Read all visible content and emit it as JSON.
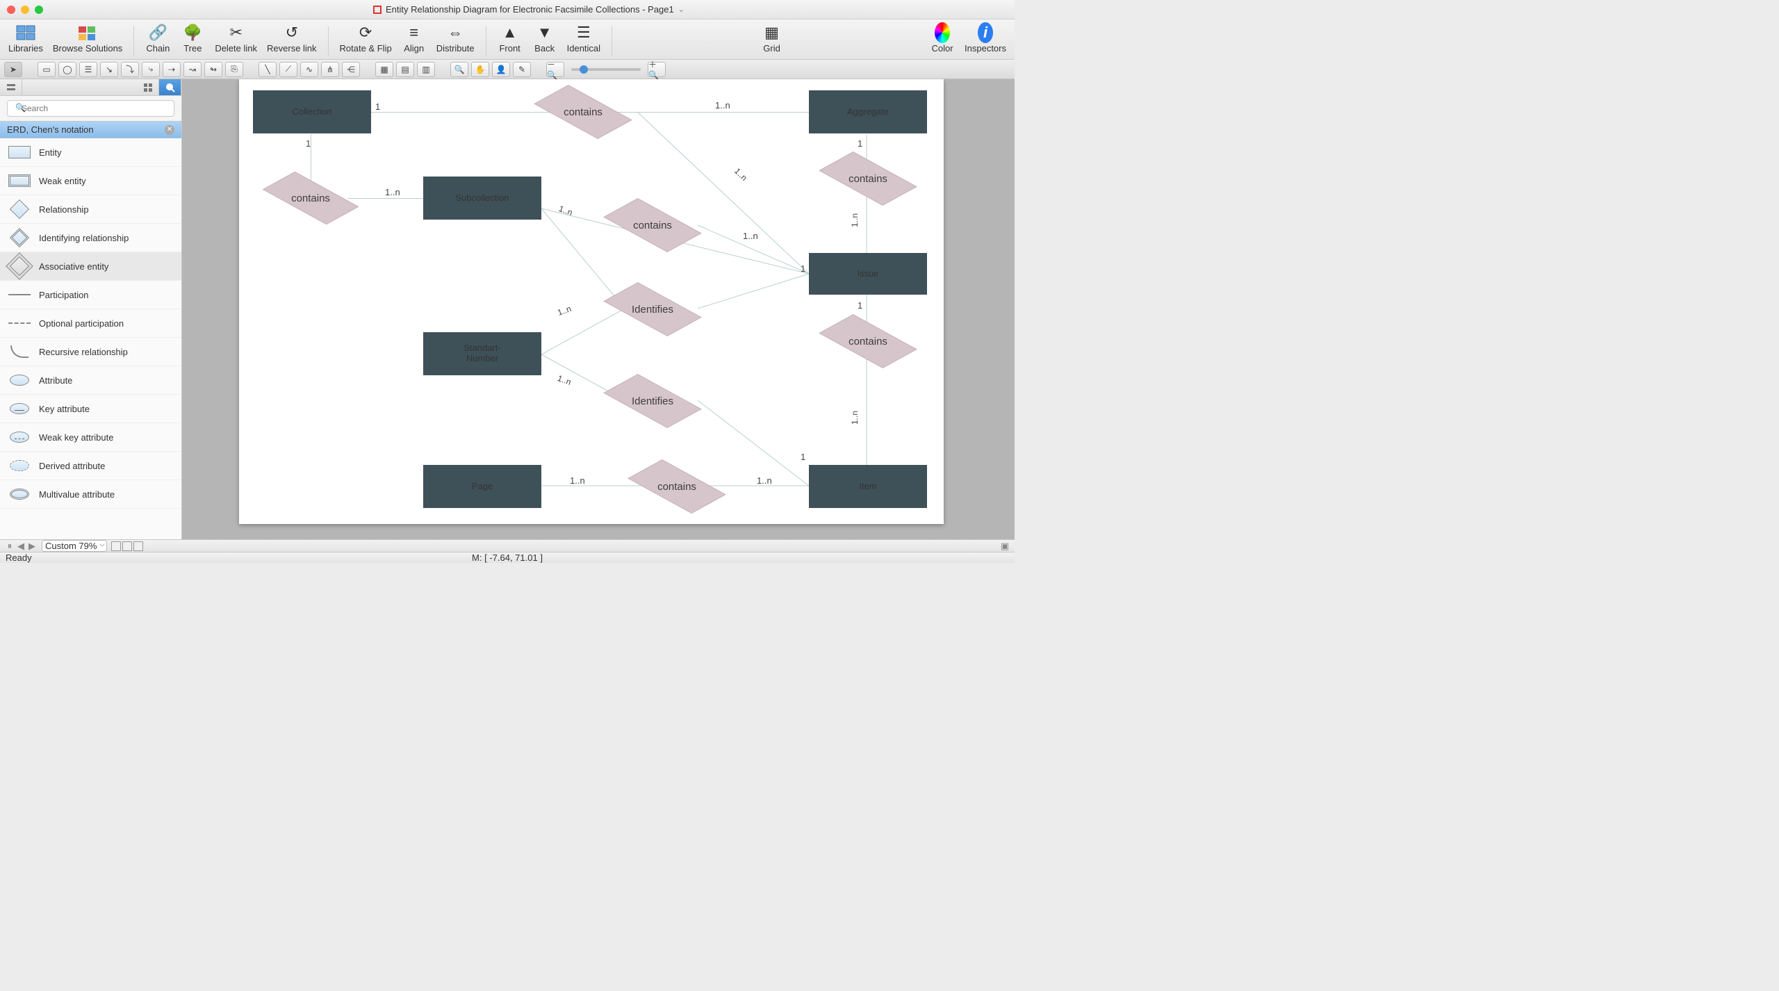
{
  "title": "Entity Relationship Diagram for Electronic Facsimile Collections - Page1",
  "ribbon": {
    "libraries": "Libraries",
    "browse": "Browse Solutions",
    "chain": "Chain",
    "tree": "Tree",
    "deleteLink": "Delete link",
    "reverseLink": "Reverse link",
    "rotate": "Rotate & Flip",
    "align": "Align",
    "distribute": "Distribute",
    "front": "Front",
    "back": "Back",
    "identical": "Identical",
    "grid": "Grid",
    "color": "Color",
    "inspectors": "Inspectors"
  },
  "search_placeholder": "Search",
  "library_title": "ERD, Chen's notation",
  "lib_items": [
    "Entity",
    "Weak entity",
    "Relationship",
    "Identifying relationship",
    "Associative entity",
    "Participation",
    "Optional participation",
    "Recursive relationship",
    "Attribute",
    "Key attribute",
    "Weak key attribute",
    "Derived attribute",
    "Multivalue attribute"
  ],
  "entities": {
    "collection": "Collection",
    "aggregate": "Aggregate",
    "subcollection": "Subcollection",
    "issue": "Issue",
    "standart": "Standart-\nNumber",
    "page": "Page",
    "item": "Item"
  },
  "rels": {
    "contains": "contains",
    "identifies": "Identifies"
  },
  "cards": {
    "c1": "1",
    "c2": "1..n"
  },
  "zoom_label": "Custom 79%",
  "status_ready": "Ready",
  "status_coords": "M: [ -7.64, 71.01 ]"
}
